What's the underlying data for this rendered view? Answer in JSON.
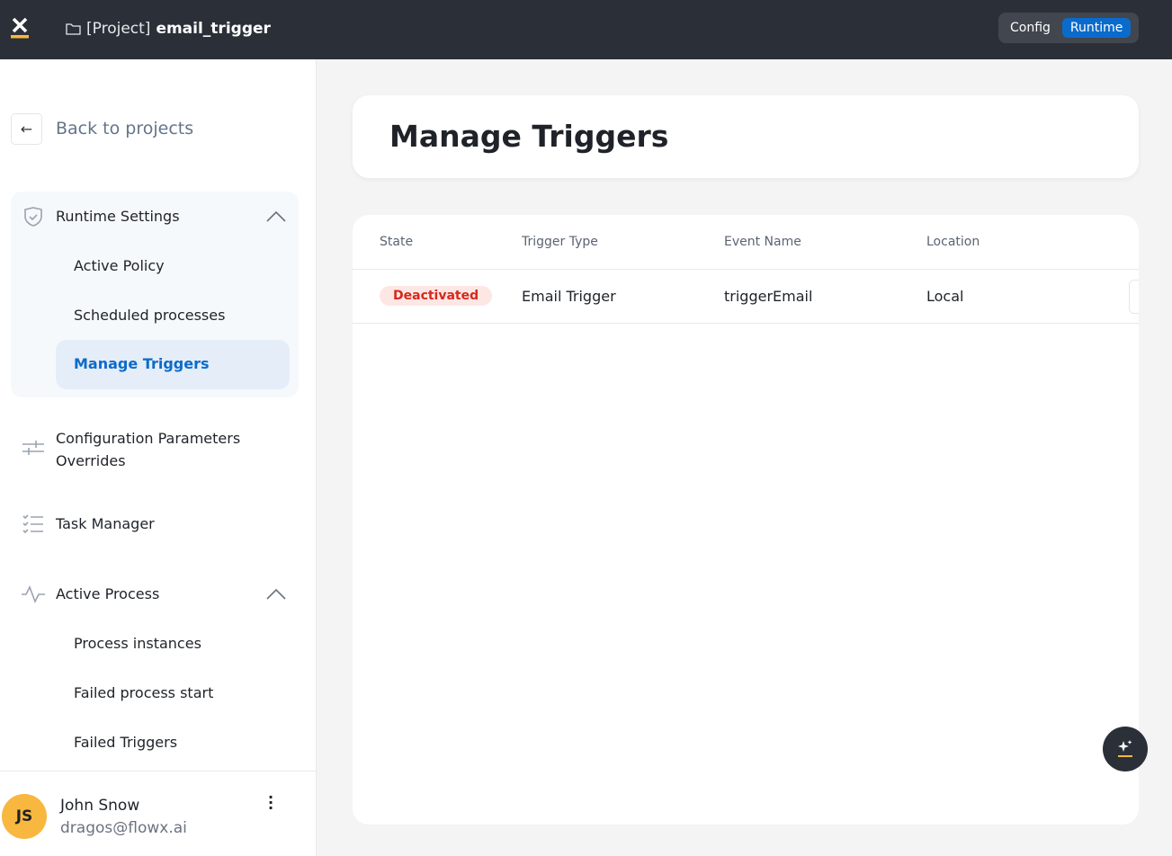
{
  "topbar": {
    "project_prefix": "[Project]",
    "project_name": "email_trigger",
    "modes": [
      "Config",
      "Runtime"
    ],
    "active_mode": "Runtime"
  },
  "sidebar": {
    "back_label": "Back to projects",
    "runtime_settings": {
      "label": "Runtime Settings",
      "items": [
        "Active Policy",
        "Scheduled processes",
        "Manage Triggers"
      ],
      "active": "Manage Triggers"
    },
    "config_overrides": "Configuration Parameters Overrides",
    "task_manager": "Task Manager",
    "active_process": {
      "label": "Active Process",
      "items": [
        "Process instances",
        "Failed process start",
        "Failed Triggers"
      ]
    },
    "user": {
      "initials": "JS",
      "name": "John Snow",
      "email": "dragos@flowx.ai"
    }
  },
  "main": {
    "title": "Manage Triggers",
    "table": {
      "columns": [
        "State",
        "Trigger Type",
        "Event Name",
        "Location"
      ],
      "rows": [
        {
          "state": "Deactivated",
          "trigger_type": "Email Trigger",
          "event_name": "triggerEmail",
          "location": "Local"
        }
      ]
    }
  },
  "colors": {
    "accent": "#0b6bcb",
    "topbar": "#2b3038",
    "logo": "#f8b73e",
    "badge_text": "#d6281c"
  }
}
